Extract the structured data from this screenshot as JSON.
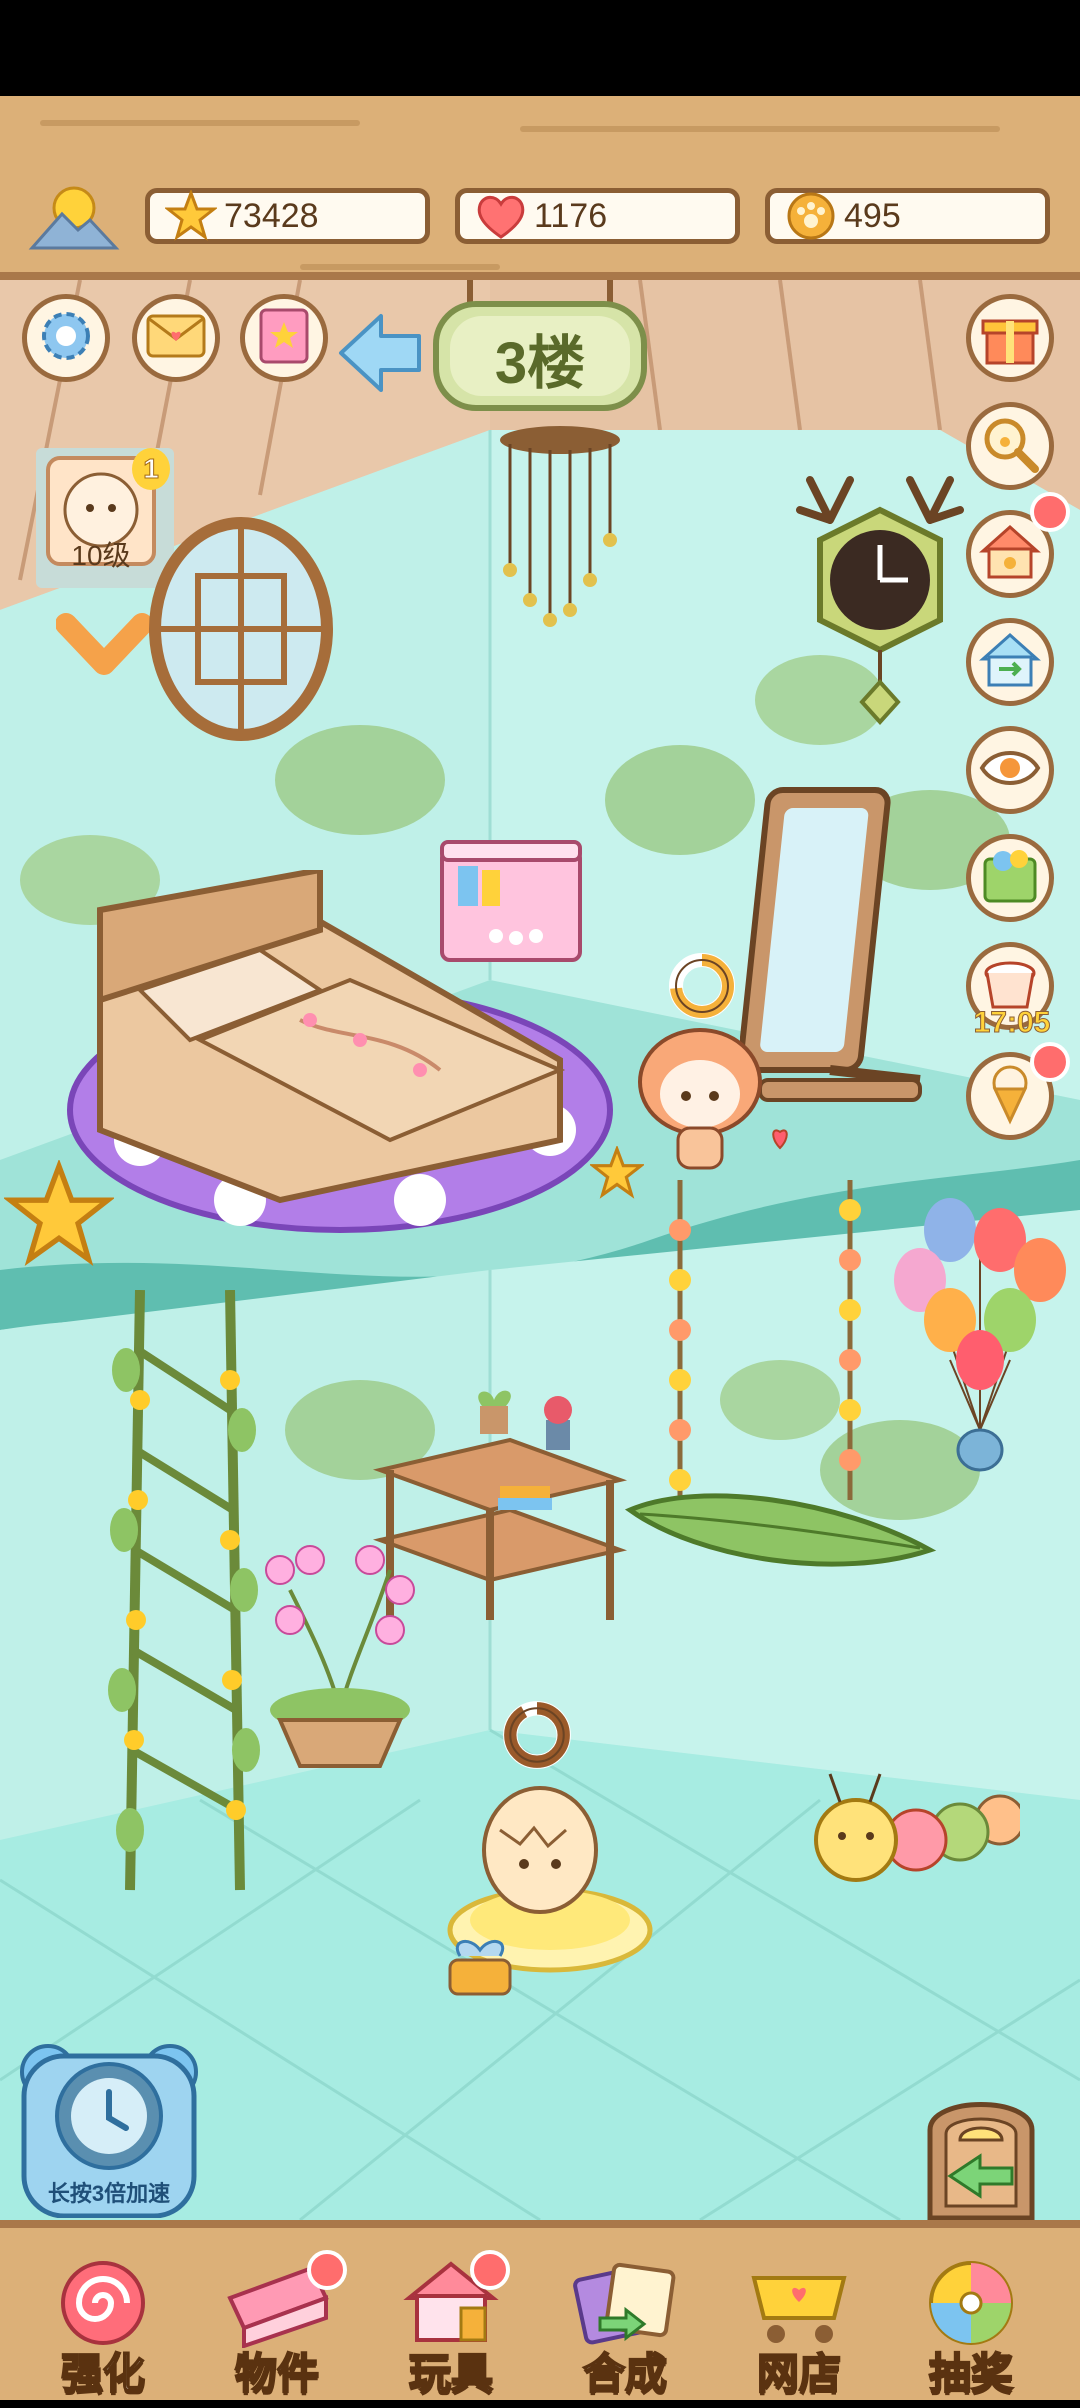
{
  "resources": {
    "stars": "73428",
    "hearts": "1176",
    "coins": "495"
  },
  "floor": {
    "label": "3楼"
  },
  "level": {
    "badge_number": "1",
    "label": "10级"
  },
  "timer": {
    "label": "17:05"
  },
  "speedup": {
    "label": "长按3倍加速"
  },
  "nav": [
    {
      "label": "强化",
      "icon": "swirl-candy-icon"
    },
    {
      "label": "物件",
      "icon": "piano-icon"
    },
    {
      "label": "玩具",
      "icon": "toy-house-icon"
    },
    {
      "label": "合成",
      "icon": "cards-icon"
    },
    {
      "label": "网店",
      "icon": "shop-cart-icon"
    },
    {
      "label": "抽奖",
      "icon": "prize-wheel-icon"
    }
  ],
  "colors": {
    "wood": "#dcb078",
    "wood_dark": "#8b5e34",
    "room": "#bdeee6",
    "accent_red": "#ff6d6d"
  }
}
